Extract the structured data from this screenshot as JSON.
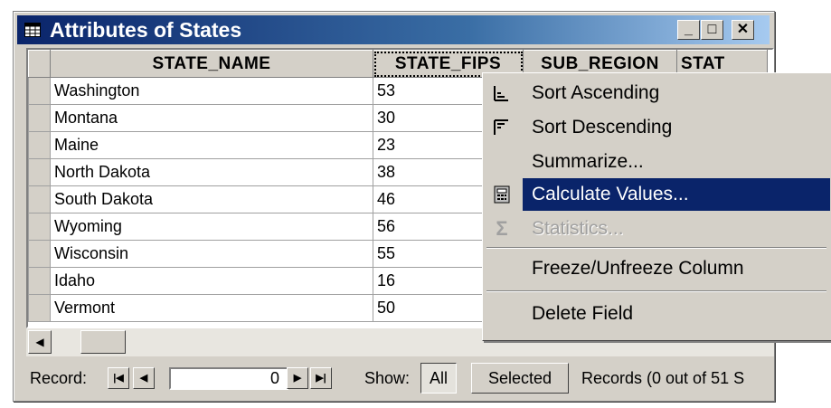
{
  "window": {
    "title": "Attributes of States",
    "controls": {
      "minimize": "_",
      "maximize": "□",
      "close": "✕"
    }
  },
  "table": {
    "columns": [
      "STATE_NAME",
      "STATE_FIPS",
      "SUB_REGION",
      "STAT"
    ],
    "rows": [
      {
        "name": "Washington",
        "fips": "53"
      },
      {
        "name": "Montana",
        "fips": "30"
      },
      {
        "name": "Maine",
        "fips": "23"
      },
      {
        "name": "North Dakota",
        "fips": "38"
      },
      {
        "name": "South Dakota",
        "fips": "46"
      },
      {
        "name": "Wyoming",
        "fips": "56"
      },
      {
        "name": "Wisconsin",
        "fips": "55"
      },
      {
        "name": "Idaho",
        "fips": "16"
      },
      {
        "name": "Vermont",
        "fips": "50"
      }
    ]
  },
  "status": {
    "record_label": "Record:",
    "record_value": "0",
    "show_label": "Show:",
    "all_label": "All",
    "selected_label": "Selected",
    "records_text": "Records (0 out of 51 S"
  },
  "context_menu": {
    "items": [
      {
        "label": "Sort Ascending",
        "icon": "sort-ascending-icon"
      },
      {
        "label": "Sort Descending",
        "icon": "sort-descending-icon"
      },
      {
        "label": "Summarize...",
        "icon": ""
      },
      {
        "label": "Calculate Values...",
        "icon": "calculator-icon",
        "highlighted": true
      },
      {
        "label": "Statistics...",
        "icon": "sigma-icon",
        "disabled": true
      },
      {
        "label": "Freeze/Unfreeze Column",
        "icon": ""
      },
      {
        "label": "Delete Field",
        "icon": ""
      }
    ]
  },
  "colors": {
    "titlebar_start": "#0a246a",
    "titlebar_end": "#a6caf0",
    "menu_highlight": "#0a246a",
    "face": "#d4d0c8"
  }
}
